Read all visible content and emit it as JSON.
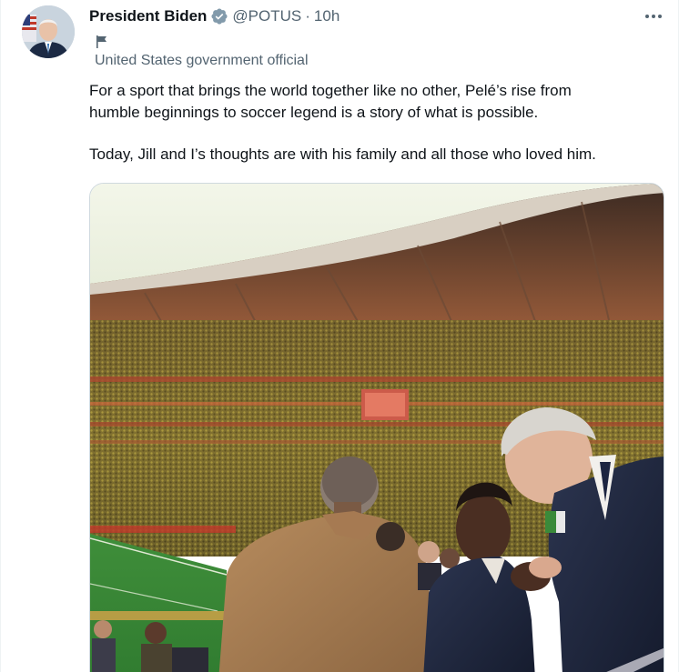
{
  "tweet": {
    "author_name": "President Biden",
    "handle": "@POTUS",
    "separator": "·",
    "time": "10h",
    "label": "United States government official",
    "text_line1": "For a sport that brings the world together like no other, Pelé’s rise from",
    "text_line2": "humble beginnings to soccer legend is a story of what is possible.",
    "text_line3": "Today, Jill and I’s thoughts are with his family and all those who loved him."
  },
  "icons": {
    "verified": "verified-badge-icon",
    "label_flag": "flag-icon",
    "more": "more-horizontal-icon"
  },
  "colors": {
    "verified_blue": "#1d9bf0",
    "secondary_text": "#536471",
    "primary_text": "#0f1419"
  }
}
